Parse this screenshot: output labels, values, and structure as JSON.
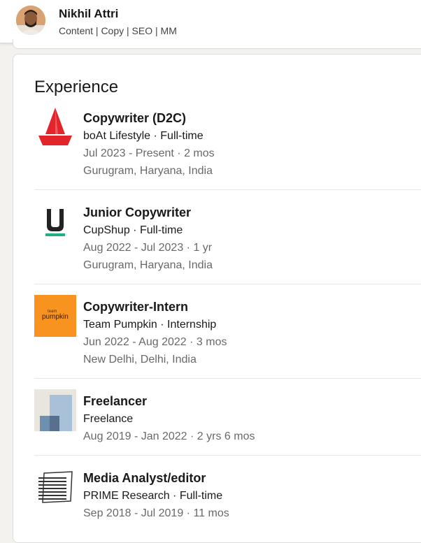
{
  "profile": {
    "name": "Nikhil Attri",
    "headline": "Content | Copy | SEO | MM"
  },
  "experience": {
    "title": "Experience",
    "items": [
      {
        "title": "Copywriter (D2C)",
        "company": "boAt Lifestyle · Full-time",
        "dates": "Jul 2023 - Present · 2 mos",
        "location": "Gurugram, Haryana, India",
        "logo": "boat-logo-icon"
      },
      {
        "title": "Junior Copywriter",
        "company": "CupShup · Full-time",
        "dates": "Aug 2022 - Jul 2023 · 1 yr",
        "location": "Gurugram, Haryana, India",
        "logo": "cupshup-logo-icon"
      },
      {
        "title": "Copywriter-Intern",
        "company": "Team Pumpkin · Internship",
        "dates": "Jun 2022 - Aug 2022 · 3 mos",
        "location": "New Delhi, Delhi, India",
        "logo": "team-pumpkin-logo-icon",
        "logo_text_small": "team",
        "logo_text": "pumpkin"
      },
      {
        "title": "Freelancer",
        "company": "Freelance",
        "dates": "Aug 2019 - Jan 2022 · 2 yrs 6 mos",
        "logo": "default-company-logo-icon"
      },
      {
        "title": "Media Analyst/editor",
        "company": "PRIME Research · Full-time",
        "dates": "Sep 2018 - Jul 2019 · 11 mos",
        "logo": "prime-research-logo-icon"
      }
    ]
  },
  "colors": {
    "boat_red": "#e3242b",
    "cupshup_green": "#1db37a",
    "pumpkin_orange": "#f7931e"
  }
}
